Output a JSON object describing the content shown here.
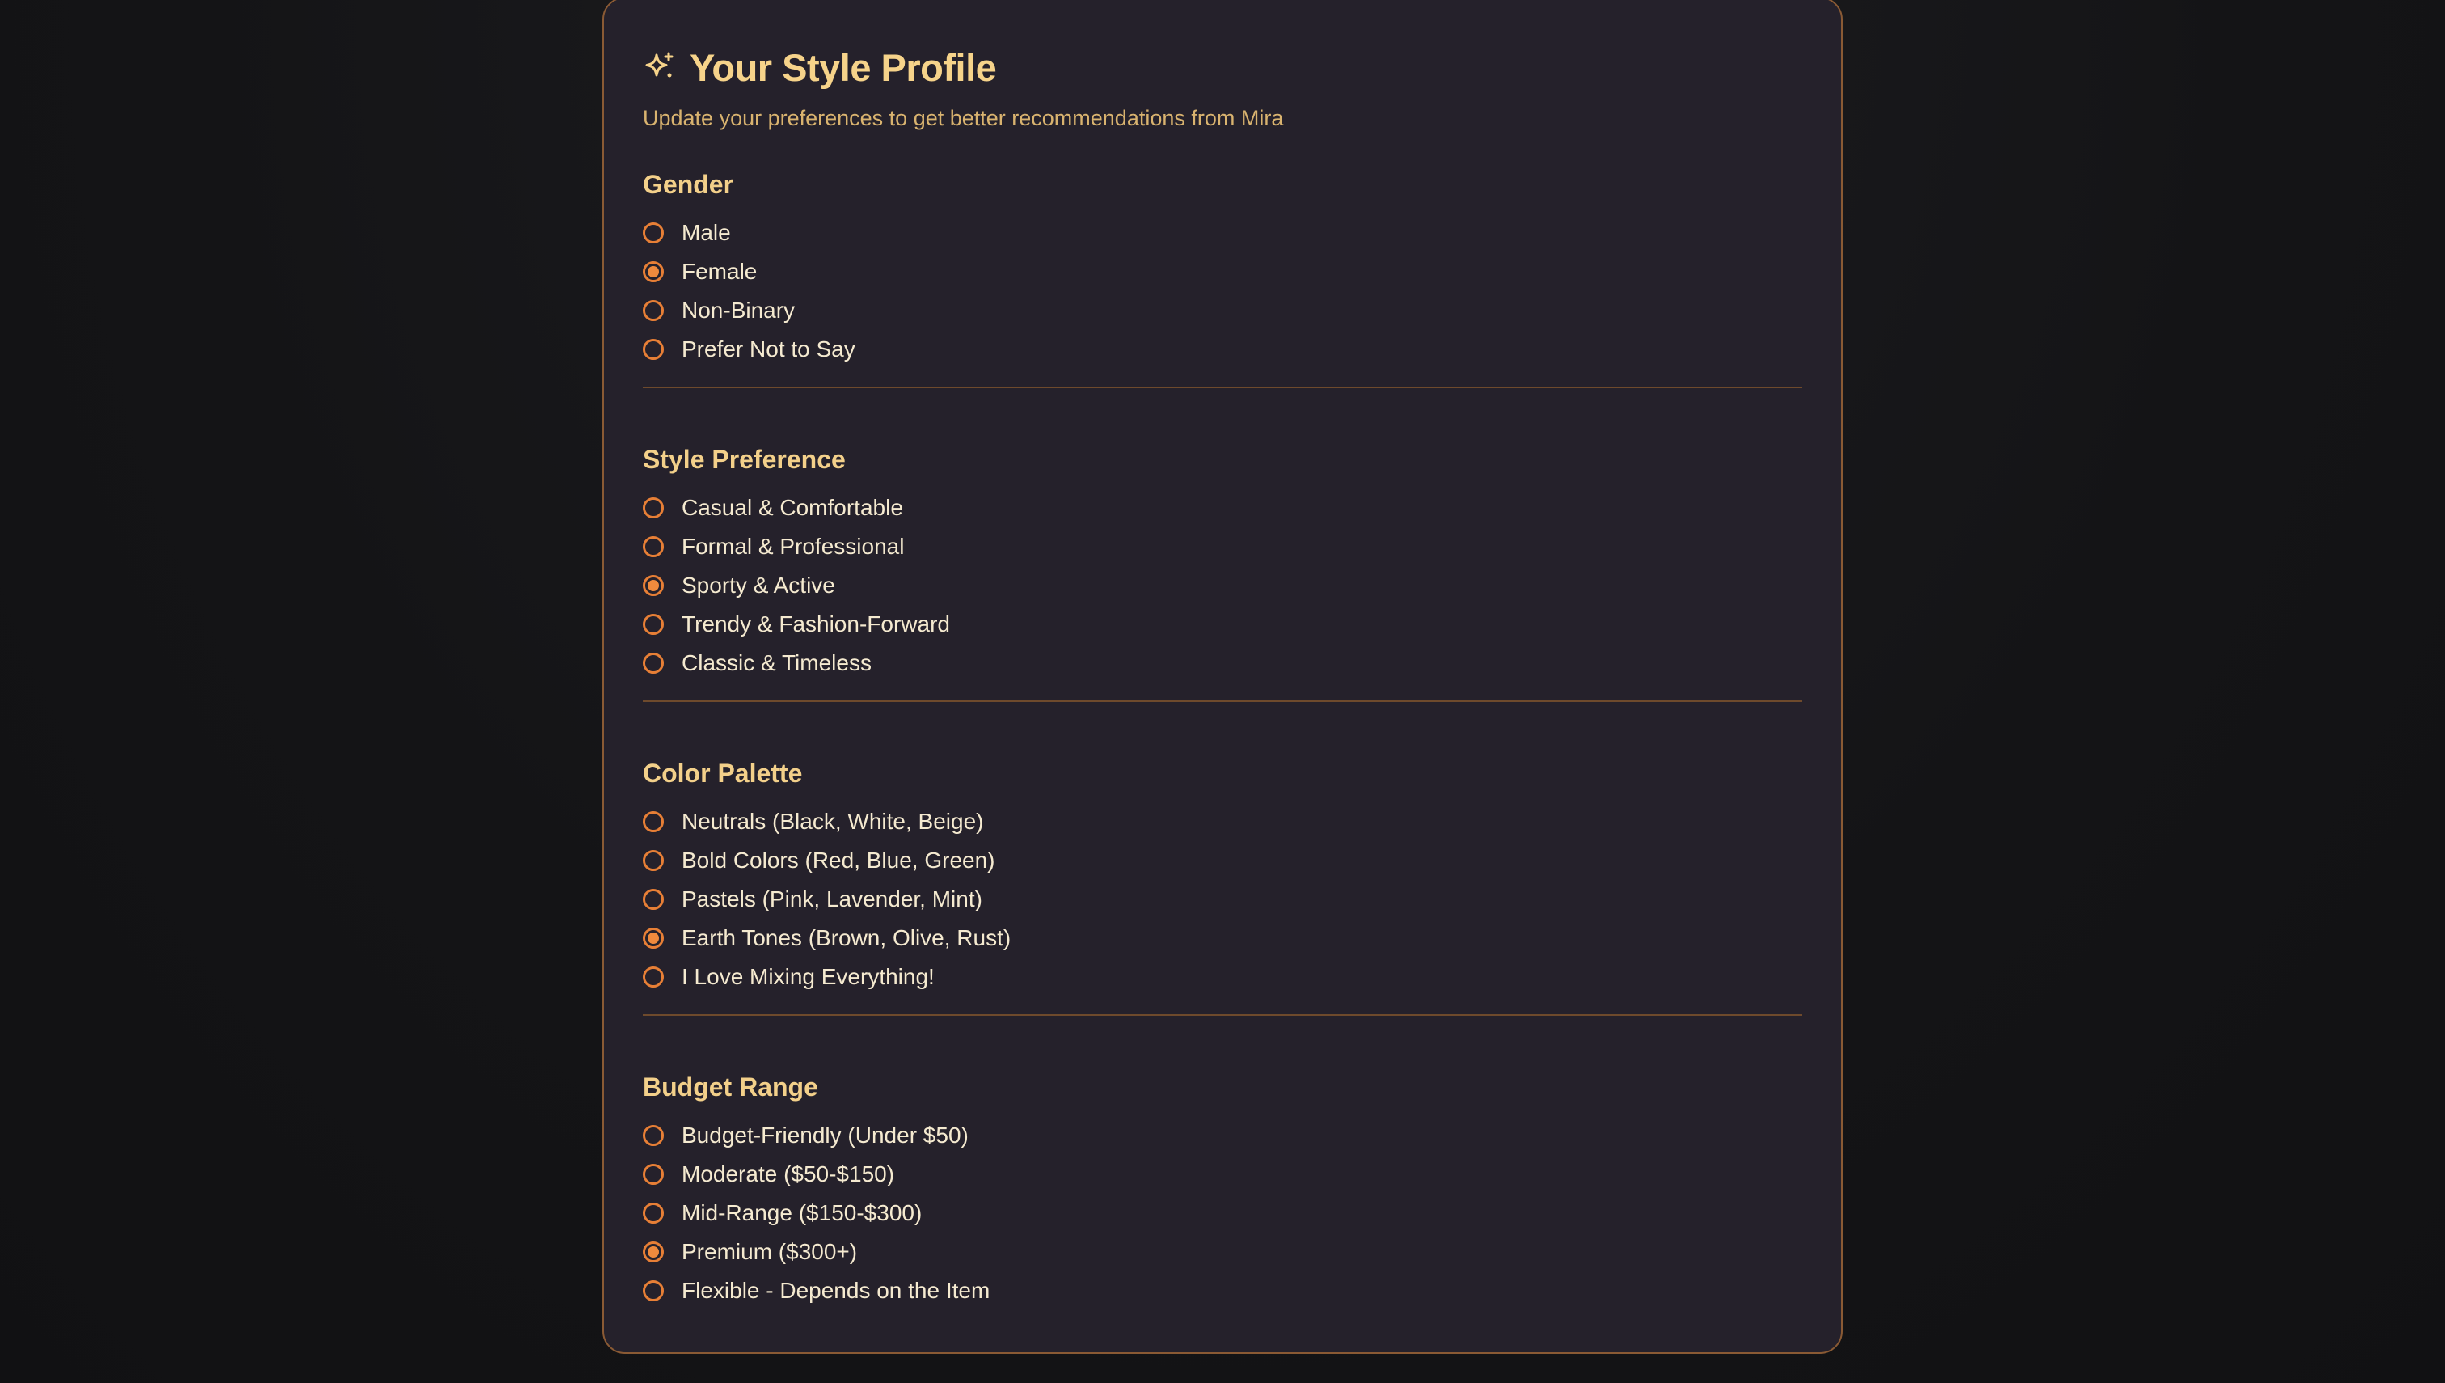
{
  "header": {
    "title": "Your Style Profile",
    "subtitle": "Update your preferences to get better recommendations from Mira",
    "icon": "sparkle-icon"
  },
  "colors": {
    "accent": "#ef8a3d",
    "title": "#f6d38a",
    "card_bg": "#25212b",
    "border": "#8a5a34"
  },
  "sections": [
    {
      "title": "Gender",
      "selected": 1,
      "options": [
        "Male",
        "Female",
        "Non-Binary",
        "Prefer Not to Say"
      ]
    },
    {
      "title": "Style Preference",
      "selected": 2,
      "options": [
        "Casual & Comfortable",
        "Formal & Professional",
        "Sporty & Active",
        "Trendy & Fashion-Forward",
        "Classic & Timeless"
      ]
    },
    {
      "title": "Color Palette",
      "selected": 3,
      "options": [
        "Neutrals (Black, White, Beige)",
        "Bold Colors (Red, Blue, Green)",
        "Pastels (Pink, Lavender, Mint)",
        "Earth Tones (Brown, Olive, Rust)",
        "I Love Mixing Everything!"
      ]
    },
    {
      "title": "Budget Range",
      "selected": 3,
      "options": [
        "Budget-Friendly (Under $50)",
        "Moderate ($50-$150)",
        "Mid-Range ($150-$300)",
        "Premium ($300+)",
        "Flexible - Depends on the Item"
      ]
    }
  ]
}
